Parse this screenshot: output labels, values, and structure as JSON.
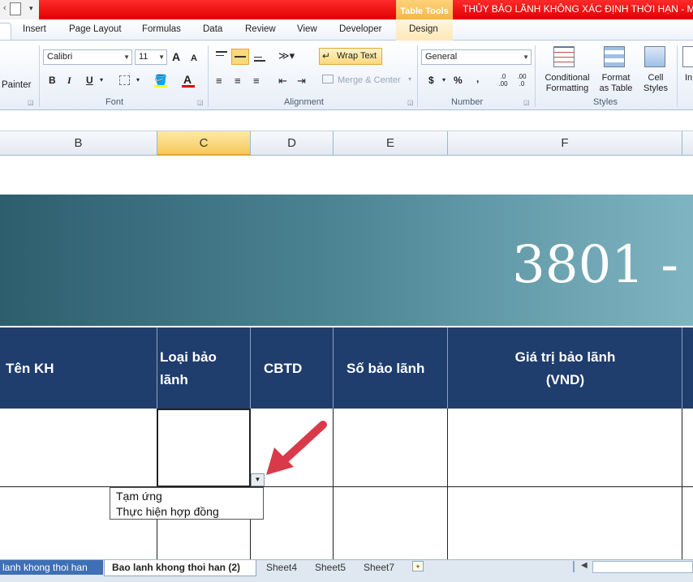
{
  "titlebar": {
    "table_tools": "Table Tools",
    "doc_title": "THỦY BẢO LÃNH KHÔNG XÁC ĐỊNH THỜI HẠN  -  Mi"
  },
  "menu": {
    "tabs": [
      "Insert",
      "Page Layout",
      "Formulas",
      "Data",
      "Review",
      "View",
      "Developer",
      "Design"
    ]
  },
  "ribbon": {
    "clipboard": {
      "painter": "Painter"
    },
    "font": {
      "name": "Calibri",
      "size": "11",
      "grow": "A",
      "shrink": "A",
      "bold": "B",
      "italic": "I",
      "underline": "U",
      "font_color": "A",
      "label": "Font"
    },
    "alignment": {
      "wrap_text": "Wrap Text",
      "merge_center": "Merge & Center",
      "label": "Alignment"
    },
    "number": {
      "format": "General",
      "currency": "$",
      "percent": "%",
      "comma": ",",
      "inc_dec": ".0 .00",
      "dec_dec": ".00 .0",
      "label": "Number"
    },
    "styles": {
      "conditional": [
        "Conditional",
        "Formatting"
      ],
      "format_table": [
        "Format",
        "as Table"
      ],
      "cell_styles": [
        "Cell",
        "Styles"
      ],
      "label": "Styles"
    },
    "cells": {
      "insert": "In"
    }
  },
  "columns": [
    "B",
    "C",
    "D",
    "E",
    "F"
  ],
  "sheet": {
    "banner_text": "3801 -",
    "headers": [
      "Tên KH",
      "Loại bảo lãnh",
      "CBTD",
      "Số bảo lãnh",
      "Giá trị bảo lãnh (VND)"
    ],
    "header_lines": {
      "c1": "Loại bảo",
      "c2": "lãnh",
      "f1": "Giá trị bảo lãnh",
      "f2": "(VND)"
    }
  },
  "dropdown": {
    "options": [
      "Tạm ứng",
      "Thực hiện hợp đồng"
    ]
  },
  "sheet_tabs": [
    "lanh khong thoi han",
    "Bao lanh khong thoi han (2)",
    "Sheet4",
    "Sheet5",
    "Sheet7"
  ],
  "colors": {
    "header_fill": "#1f3d6d",
    "banner_start": "#2d5e6e",
    "banner_end": "#7fb5c2",
    "arrow": "#d83a4a",
    "title_red": "#e00000"
  }
}
